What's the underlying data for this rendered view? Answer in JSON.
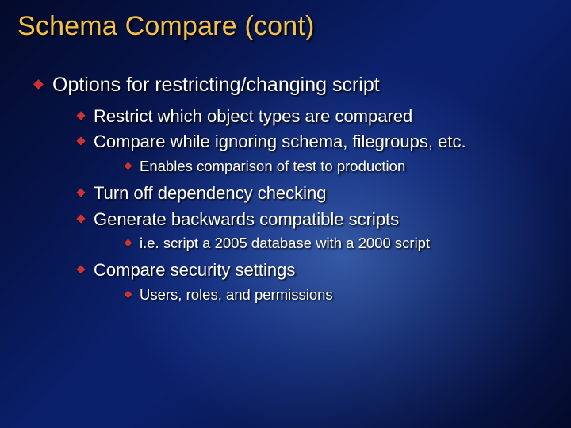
{
  "title": "Schema Compare (cont)",
  "bullets": {
    "lvl1": [
      {
        "text": "Options for restricting/changing script",
        "lvl2": [
          {
            "text": "Restrict which object types are compared"
          },
          {
            "text": "Compare while ignoring schema, filegroups, etc.",
            "lvl3": [
              {
                "text": "Enables comparison of test to production"
              }
            ]
          },
          {
            "text": "Turn off dependency checking"
          },
          {
            "text": "Generate backwards compatible scripts",
            "lvl3": [
              {
                "text": "i.e. script a 2005 database with a 2000 script"
              }
            ]
          },
          {
            "text": "Compare security settings",
            "lvl3": [
              {
                "text": "Users, roles, and permissions"
              }
            ]
          }
        ]
      }
    ]
  }
}
